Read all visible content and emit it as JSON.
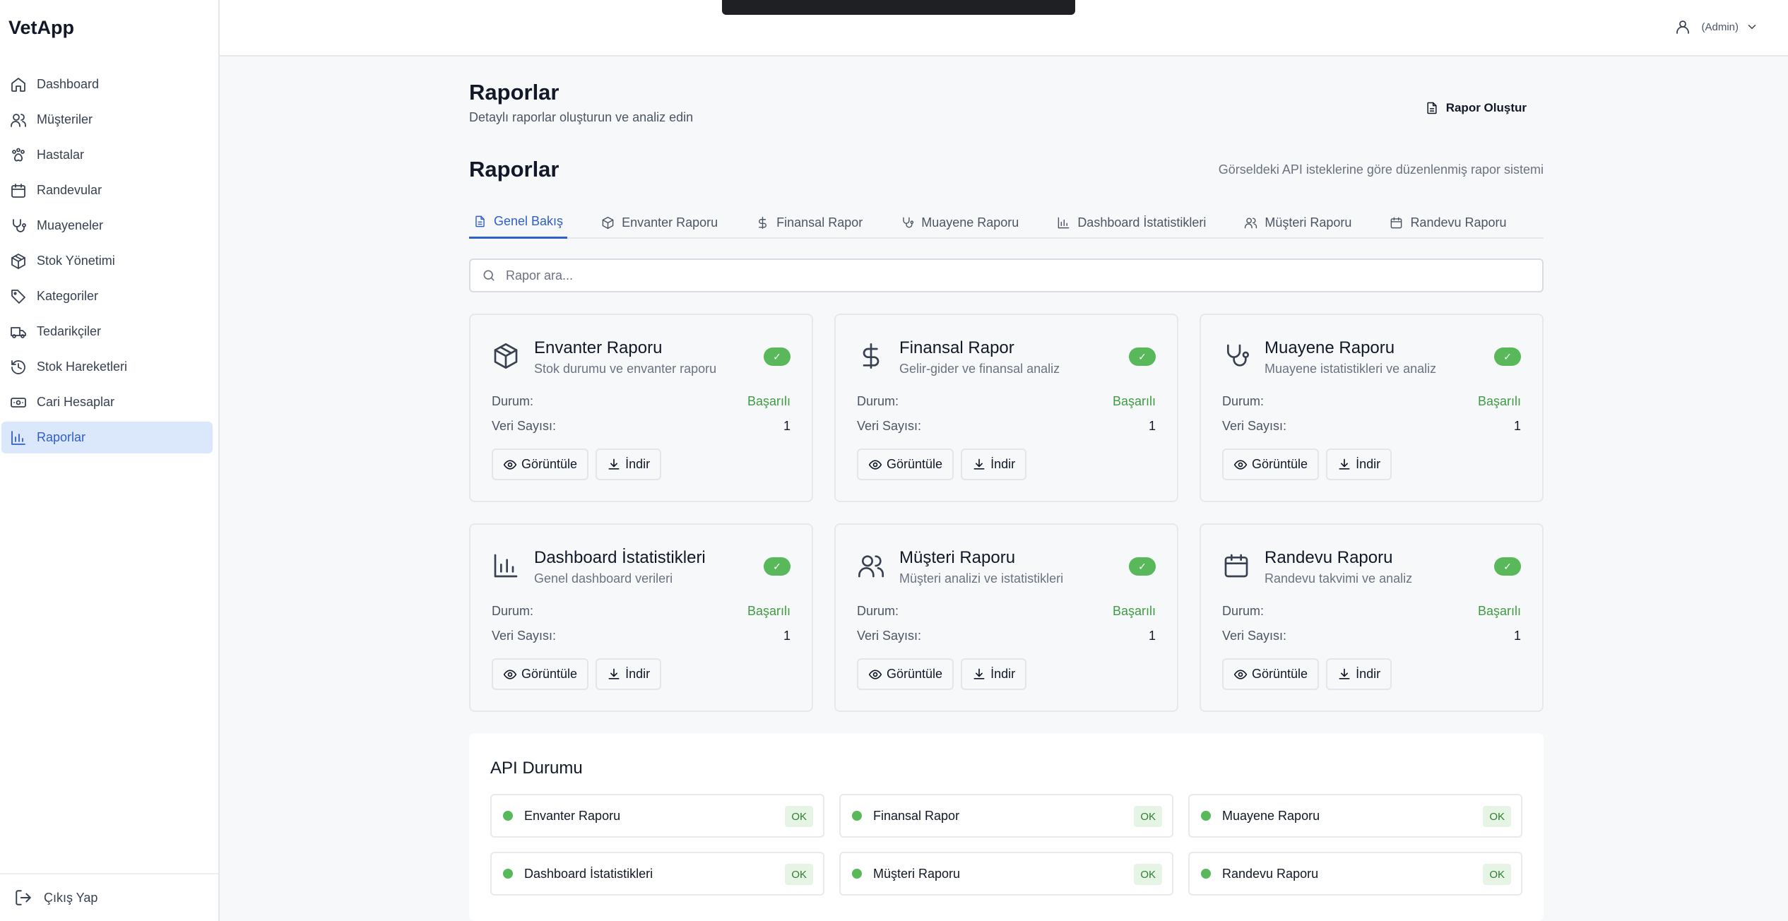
{
  "app": {
    "logo": "VetApp",
    "user_role": "(Admin)"
  },
  "sidebar": {
    "items": [
      {
        "label": "Dashboard",
        "icon": "home-icon"
      },
      {
        "label": "Müşteriler",
        "icon": "users-icon"
      },
      {
        "label": "Hastalar",
        "icon": "paw-icon"
      },
      {
        "label": "Randevular",
        "icon": "calendar-icon"
      },
      {
        "label": "Muayeneler",
        "icon": "stethoscope-icon"
      },
      {
        "label": "Stok Yönetimi",
        "icon": "box-icon"
      },
      {
        "label": "Kategoriler",
        "icon": "tag-icon"
      },
      {
        "label": "Tedarikçiler",
        "icon": "truck-icon"
      },
      {
        "label": "Stok Hareketleri",
        "icon": "history-icon"
      },
      {
        "label": "Cari Hesaplar",
        "icon": "banknote-icon"
      },
      {
        "label": "Raporlar",
        "icon": "bar-chart-icon",
        "active": true
      }
    ],
    "logout": "Çıkış Yap"
  },
  "page": {
    "title": "Raporlar",
    "subtitle": "Detaylı raporlar oluşturun ve analiz edin",
    "create_button": "Rapor Oluştur",
    "section_title": "Raporlar",
    "section_note": "Görseldeki API isteklerine göre düzenlenmiş rapor sistemi"
  },
  "tabs": [
    {
      "label": "Genel Bakış",
      "icon": "file-icon",
      "active": true
    },
    {
      "label": "Envanter Raporu",
      "icon": "box-icon"
    },
    {
      "label": "Finansal Rapor",
      "icon": "dollar-icon"
    },
    {
      "label": "Muayene Raporu",
      "icon": "stethoscope-icon"
    },
    {
      "label": "Dashboard İstatistikleri",
      "icon": "bar-chart-icon"
    },
    {
      "label": "Müşteri Raporu",
      "icon": "users-icon"
    },
    {
      "label": "Randevu Raporu",
      "icon": "calendar-icon"
    }
  ],
  "search": {
    "placeholder": "Rapor ara..."
  },
  "card_labels": {
    "status": "Durum:",
    "count": "Veri Sayısı:",
    "view": "Görüntüle",
    "download": "İndir",
    "check": "✓"
  },
  "cards": [
    {
      "title": "Envanter Raporu",
      "desc": "Stok durumu ve envanter raporu",
      "status": "Başarılı",
      "count": "1",
      "icon": "box-icon"
    },
    {
      "title": "Finansal Rapor",
      "desc": "Gelir-gider ve finansal analiz",
      "status": "Başarılı",
      "count": "1",
      "icon": "dollar-icon"
    },
    {
      "title": "Muayene Raporu",
      "desc": "Muayene istatistikleri ve analiz",
      "status": "Başarılı",
      "count": "1",
      "icon": "stethoscope-icon"
    },
    {
      "title": "Dashboard İstatistikleri",
      "desc": "Genel dashboard verileri",
      "status": "Başarılı",
      "count": "1",
      "icon": "bar-chart-icon"
    },
    {
      "title": "Müşteri Raporu",
      "desc": "Müşteri analizi ve istatistikleri",
      "status": "Başarılı",
      "count": "1",
      "icon": "users-icon"
    },
    {
      "title": "Randevu Raporu",
      "desc": "Randevu takvimi ve analiz",
      "status": "Başarılı",
      "count": "1",
      "icon": "calendar-icon"
    }
  ],
  "api": {
    "title": "API Durumu",
    "items": [
      {
        "name": "Envanter Raporu",
        "status": "OK"
      },
      {
        "name": "Finansal Rapor",
        "status": "OK"
      },
      {
        "name": "Muayene Raporu",
        "status": "OK"
      },
      {
        "name": "Dashboard İstatistikleri",
        "status": "OK"
      },
      {
        "name": "Müşteri Raporu",
        "status": "OK"
      },
      {
        "name": "Randevu Raporu",
        "status": "OK"
      }
    ]
  },
  "colors": {
    "accent": "#2f5fc9",
    "active_bg": "#dbe7fb",
    "success": "#58b85a"
  }
}
